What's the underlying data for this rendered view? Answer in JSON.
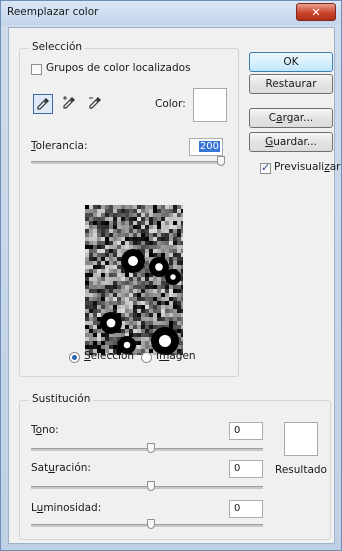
{
  "window": {
    "title": "Reemplazar color",
    "close_glyph": "✕"
  },
  "seleccion": {
    "legend": "Selección",
    "grupos_label": "Grupos de color localizados",
    "grupos_checked": false,
    "color_label": "Color:",
    "color_value": "#ffffff",
    "tolerancia_label": "Tolerancia:",
    "tolerancia_value": "200",
    "tolerancia_max": 200,
    "tools": [
      "eyedropper-icon",
      "eyedropper-plus-icon",
      "eyedropper-minus-icon"
    ],
    "view_options": [
      {
        "label": "Selección",
        "selected": true
      },
      {
        "label": "Imagen",
        "selected": false
      }
    ]
  },
  "buttons": {
    "ok": "OK",
    "restaurar": "Restaurar",
    "cargar": "Cargar...",
    "guardar": "Guardar..."
  },
  "previsualizar": {
    "label": "Previsualizar",
    "checked": true
  },
  "sustitucion": {
    "legend": "Sustitución",
    "tono_label": "Tono:",
    "tono_value": "0",
    "saturacion_label": "Saturación:",
    "saturacion_value": "0",
    "luminosidad_label": "Luminosidad:",
    "luminosidad_value": "0",
    "resultado_label": "Resultado",
    "resultado_color": "#ffffff"
  }
}
